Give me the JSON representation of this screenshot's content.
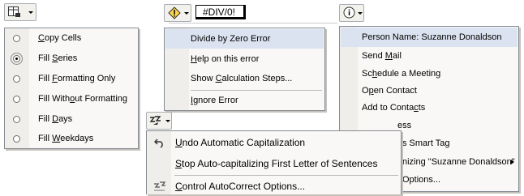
{
  "paste_options": {
    "items": [
      {
        "pre": "",
        "ul": "C",
        "post": "opy Cells",
        "selected": false
      },
      {
        "pre": "Fill ",
        "ul": "S",
        "post": "eries",
        "selected": true
      },
      {
        "pre": "Fill ",
        "ul": "F",
        "post": "ormatting Only",
        "selected": false
      },
      {
        "pre": "Fill With",
        "ul": "o",
        "post": "ut Formatting",
        "selected": false
      },
      {
        "pre": "Fill ",
        "ul": "D",
        "post": "ays",
        "selected": false
      },
      {
        "pre": "Fill ",
        "ul": "W",
        "post": "eekdays",
        "selected": false
      }
    ]
  },
  "error_options": {
    "cell_value": "#DIV/0!",
    "items": [
      {
        "pre": "",
        "ul": "",
        "post": "Divide by Zero Error"
      },
      {
        "pre": "",
        "ul": "H",
        "post": "elp on this error"
      },
      {
        "pre": "Show ",
        "ul": "C",
        "post": "alculation Steps..."
      },
      {
        "pre": "",
        "ul": "I",
        "post": "gnore Error"
      }
    ]
  },
  "smart_tag": {
    "items": [
      {
        "pre": "",
        "ul": "",
        "post": "Person Name: Suzanne Donaldson"
      },
      {
        "pre": "Send ",
        "ul": "M",
        "post": "ail"
      },
      {
        "pre": "Sc",
        "ul": "h",
        "post": "edule a Meeting"
      },
      {
        "pre": "O",
        "ul": "p",
        "post": "en Contact"
      },
      {
        "pre": "Add to Conta",
        "ul": "c",
        "post": "ts"
      },
      {
        "pre": "",
        "ul": "",
        "post": "ess"
      },
      {
        "pre": "",
        "ul": "",
        "post": "s Smart Tag"
      },
      {
        "pre": "",
        "ul": "",
        "post": "nizing \"Suzanne Donaldson\""
      },
      {
        "pre": "",
        "ul": "",
        "post": "Options..."
      }
    ]
  },
  "autocorrect": {
    "items": [
      {
        "pre": "",
        "ul": "U",
        "post": "ndo Automatic Capitalization"
      },
      {
        "pre": "",
        "ul": "S",
        "post": "top Auto-capitalizing First Letter of Sentences"
      },
      {
        "pre": "",
        "ul": "C",
        "post": "ontrol AutoCorrect Options..."
      }
    ]
  }
}
